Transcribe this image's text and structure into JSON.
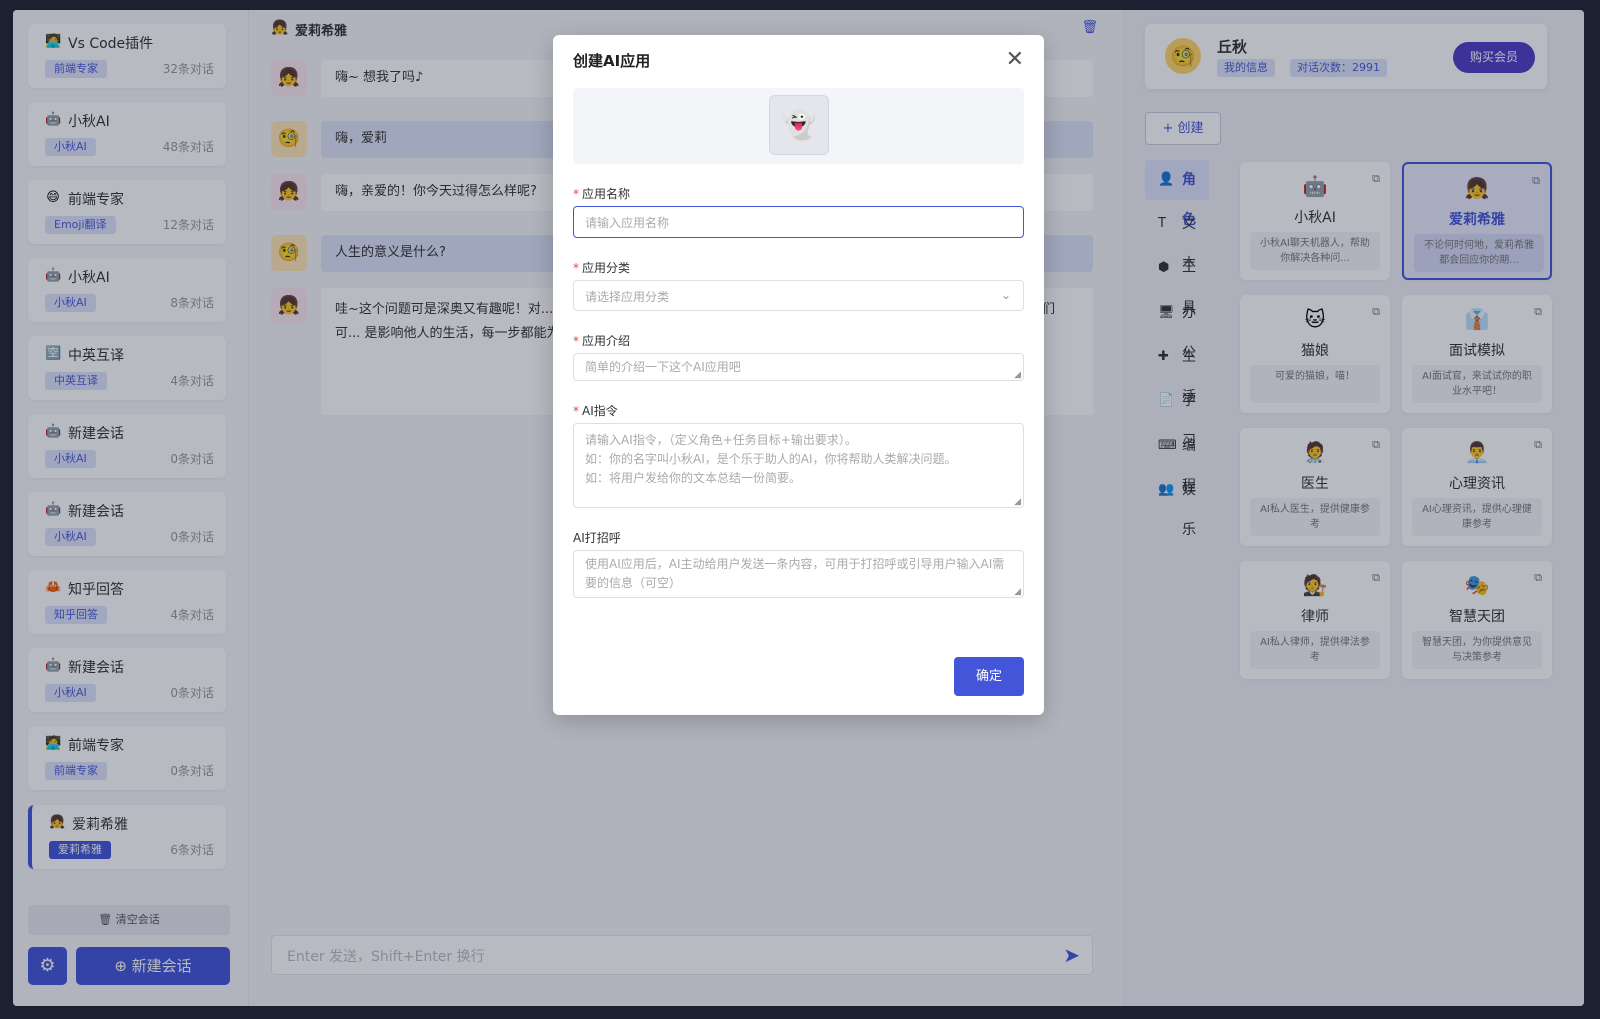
{
  "sidebar": {
    "conversations": [
      {
        "icon": "🧑‍💻",
        "title": "Vs Code插件",
        "tag": "前端专家",
        "count": "32条对话"
      },
      {
        "icon": "🤖",
        "title": "小秋AI",
        "tag": "小秋AI",
        "count": "48条对话"
      },
      {
        "icon": "😄",
        "title": "前端专家",
        "tag": "Emoji翻译",
        "count": "12条对话"
      },
      {
        "icon": "🤖",
        "title": "小秋AI",
        "tag": "小秋AI",
        "count": "8条对话"
      },
      {
        "icon": "🈳",
        "title": "中英互译",
        "tag": "中英互译",
        "count": "4条对话"
      },
      {
        "icon": "🤖",
        "title": "新建会话",
        "tag": "小秋AI",
        "count": "0条对话"
      },
      {
        "icon": "🤖",
        "title": "新建会话",
        "tag": "小秋AI",
        "count": "0条对话"
      },
      {
        "icon": "🦀",
        "title": "知乎回答",
        "tag": "知乎回答",
        "count": "4条对话"
      },
      {
        "icon": "🤖",
        "title": "新建会话",
        "tag": "小秋AI",
        "count": "0条对话"
      },
      {
        "icon": "🧑‍💻",
        "title": "前端专家",
        "tag": "前端专家",
        "count": "0条对话"
      },
      {
        "icon": "👧",
        "title": "爱莉希雅",
        "tag": "爱莉希雅",
        "count": "6条对话"
      }
    ],
    "clear_label": "🗑 清空会话",
    "new_label": "⊕ 新建会话",
    "gear_icon": "⚙"
  },
  "chat": {
    "name": "爱莉希雅",
    "messages": [
      {
        "role": "ai",
        "text": "嗨~ 想我了吗♪"
      },
      {
        "role": "user",
        "text": "嗨，爱莉"
      },
      {
        "role": "ai",
        "text": "嗨，亲爱的！你今天过得怎么样呢?"
      },
      {
        "role": "user",
        "text": "人生的意义是什么?"
      },
      {
        "role": "ai",
        "text": "哇~这个问题可是深奥又有趣呢！对... 而和成长，找到自己的快乐和满足感。每个... 也是与他人相互连接和分享的旅程，我们可... 是影响他人的生活，每一步都能为我们的人生... 受当下，每一天都会是新的开始哦~♪"
      }
    ],
    "input_placeholder": "Enter 发送，Shift+Enter 换行"
  },
  "profile": {
    "name": "丘秋",
    "tag_info": "我的信息",
    "tag_count": "对话次数：2991",
    "buy_label": "购买会员"
  },
  "create_label": "+ 创建",
  "categories": [
    {
      "icon": "👤",
      "label": "角色"
    },
    {
      "icon": "T",
      "label": "文本"
    },
    {
      "icon": "⬢",
      "label": "工具"
    },
    {
      "icon": "🖥",
      "label": "办公"
    },
    {
      "icon": "✚",
      "label": "生活"
    },
    {
      "icon": "📄",
      "label": "学习"
    },
    {
      "icon": "⌨",
      "label": "编程"
    },
    {
      "icon": "👥",
      "label": "娱乐"
    }
  ],
  "cards": [
    {
      "icon": "🤖",
      "name": "小秋AI",
      "desc": "小秋AI聊天机器人，帮助你解决各种问..."
    },
    {
      "icon": "👧",
      "name": "爱莉希雅",
      "desc": "不论何时何地，爱莉希雅都会回应你的期..."
    },
    {
      "icon": "🐱",
      "name": "猫娘",
      "desc": "可爱的猫娘，喵！"
    },
    {
      "icon": "👔",
      "name": "面试模拟",
      "desc": "AI面试官，来试试你的职业水平吧！"
    },
    {
      "icon": "🧑‍⚕️",
      "name": "医生",
      "desc": "AI私人医生，提供健康参考"
    },
    {
      "icon": "👨‍💼",
      "name": "心理资讯",
      "desc": "AI心理资讯，提供心理健康参考"
    },
    {
      "icon": "🧑‍⚖️",
      "name": "律师",
      "desc": "AI私人律师，提供律法参考"
    },
    {
      "icon": "🎭",
      "name": "智慧天团",
      "desc": "智慧天团，为你提供意见与决策参考"
    }
  ],
  "modal": {
    "title": "创建AI应用",
    "close_icon": "✕",
    "ghost_icon": "👻",
    "name_label": "应用名称",
    "name_placeholder": "请输入应用名称",
    "category_label": "应用分类",
    "category_placeholder": "请选择应用分类",
    "intro_label": "应用介绍",
    "intro_placeholder": "简单的介绍一下这个AI应用吧",
    "prompt_label": "AI指令",
    "prompt_placeholder": "请输入AI指令，（定义角色+任务目标+输出要求）。\n如：你的名字叫小秋AI，是个乐于助人的AI，你将帮助人类解决问题。\n如：将用户发给你的文本总结一份简要。",
    "greet_label": "AI打招呼",
    "greet_placeholder": "使用AI应用后，AI主动给用户发送一条内容，可用于打招呼或引导用户输入AI需要的信息（可空）",
    "confirm_label": "确定"
  }
}
